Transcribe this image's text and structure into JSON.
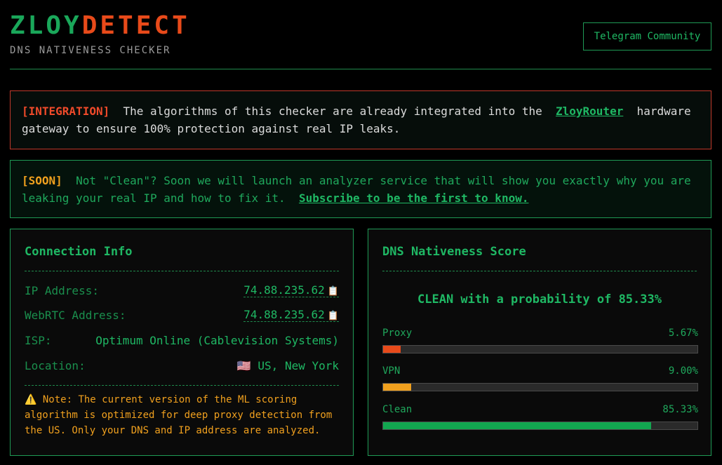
{
  "header": {
    "logo_part1": "ZLOY",
    "logo_part2": "DETECT",
    "tagline": "DNS NATIVENESS CHECKER",
    "telegram_button": "Telegram Community"
  },
  "integration_banner": {
    "tag": "[INTEGRATION]",
    "text_before": "The algorithms of this checker are already integrated into the",
    "link": "ZloyRouter",
    "text_after": "hardware gateway to ensure 100% protection against real IP leaks."
  },
  "soon_banner": {
    "tag": "[SOON]",
    "text": "Not \"Clean\"? Soon we will launch an analyzer service that will show you exactly why you are leaking your real IP and how to fix it.",
    "link": "Subscribe to be the first to know."
  },
  "connection_info": {
    "title": "Connection Info",
    "ip_label": "IP Address:",
    "ip_value": "74.88.235.62",
    "webrtc_label": "WebRTC Address:",
    "webrtc_value": "74.88.235.62",
    "isp_label": "ISP:",
    "isp_value": "Optimum Online (Cablevision Systems)",
    "location_label": "Location:",
    "location_flag": "🇺🇸",
    "location_value": "US, New York",
    "note_icon": "⚠️",
    "note": "Note: The current version of the ML scoring algorithm is optimized for deep proxy detection from the US. Only your DNS and IP address are analyzed."
  },
  "score": {
    "title": "DNS Nativeness Score",
    "verdict": "CLEAN with a probability of 85.33%",
    "metrics": [
      {
        "label": "Proxy",
        "value_text": "5.67%",
        "fraction": 0.0567,
        "color": "#e84a1a"
      },
      {
        "label": "VPN",
        "value_text": "9.00%",
        "fraction": 0.09,
        "color": "#f0a01e"
      },
      {
        "label": "Clean",
        "value_text": "85.33%",
        "fraction": 0.8533,
        "color": "#12a650"
      }
    ]
  },
  "icons": {
    "clipboard": "clipboard-icon",
    "warning": "warning-icon",
    "flag": "us-flag-icon"
  }
}
